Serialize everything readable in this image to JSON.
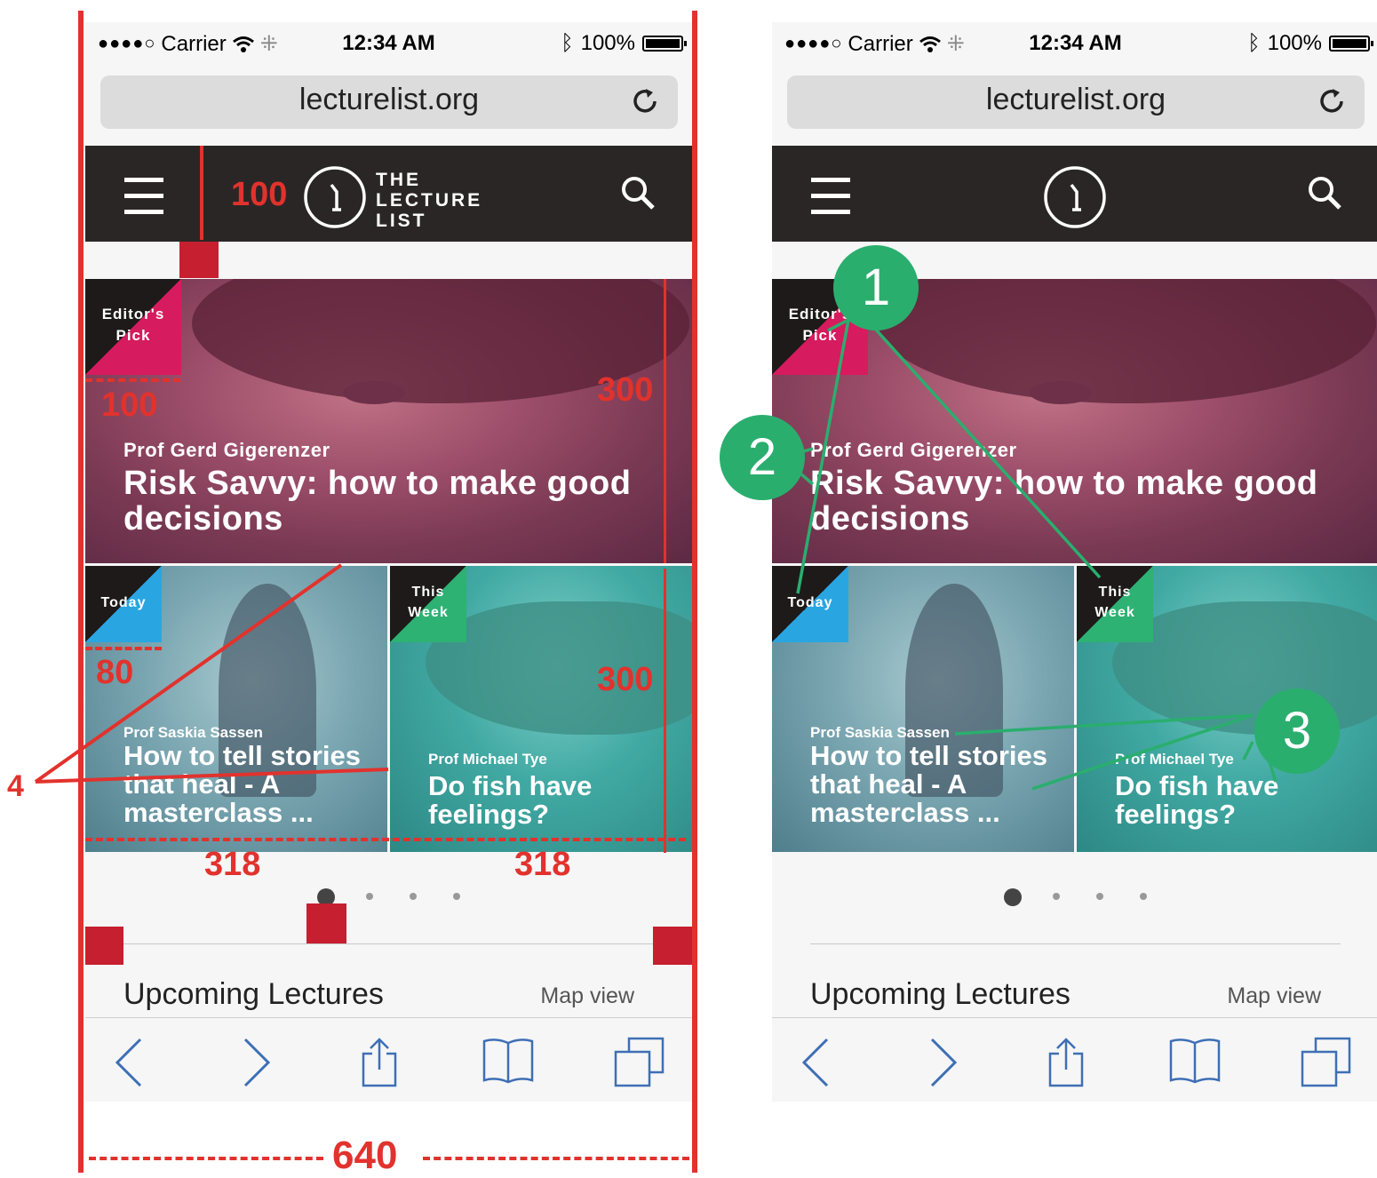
{
  "status_bar": {
    "signal": "●●●●○",
    "carrier": "Carrier",
    "time": "12:34 AM",
    "battery": "100%"
  },
  "browser": {
    "url": "lecturelist.org"
  },
  "site": {
    "logo_text": "THE LECTURE LIST"
  },
  "featured": {
    "badge": "Editor's Pick",
    "speaker": "Prof Gerd Gigerenzer",
    "title": "Risk Savvy: how to make good decisions"
  },
  "tiles": [
    {
      "badge": "Today",
      "speaker": "Prof Saskia Sassen",
      "title": "How to tell stories that heal - A masterclass ..."
    },
    {
      "badge": "This Week",
      "speaker": "Prof Michael Tye",
      "title": "Do fish have feelings?"
    }
  ],
  "section": {
    "title": "Upcoming Lectures",
    "link": "Map view"
  },
  "pager": {
    "count": 4,
    "active": 0
  },
  "annotations": {
    "nav_height": "100",
    "corner_size": "100",
    "hero_height": "300",
    "tile_corner": "80",
    "tile_height": "300",
    "tile_width_left": "318",
    "tile_width_right": "318",
    "page_width": "640",
    "callout_4": "4",
    "badge_1": "1",
    "badge_2": "2",
    "badge_3": "3"
  },
  "colors": {
    "nav": "#2b2626",
    "pink": "#d61b5e",
    "blue": "#29a6e2",
    "green": "#2db273",
    "annotation_red": "#e2322d",
    "annotation_green": "#2aae6e"
  }
}
